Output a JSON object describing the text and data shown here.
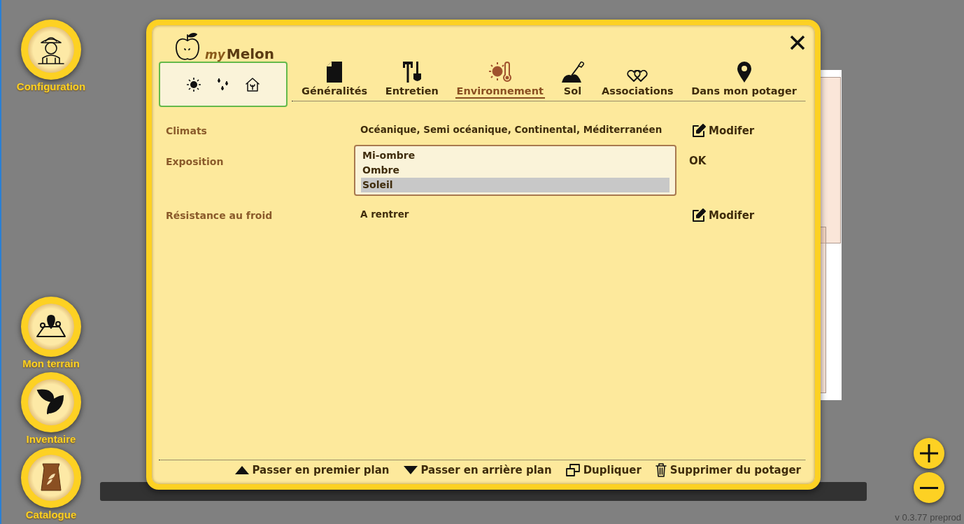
{
  "sidebar": {
    "items": [
      {
        "label": "Configuration"
      },
      {
        "label": "Mon terrain"
      },
      {
        "label": "Inventaire"
      },
      {
        "label": "Catalogue"
      }
    ]
  },
  "version": "v 0.3.77 preprod",
  "dialog": {
    "logo": {
      "prefix": "my",
      "name": "Melon"
    },
    "tabs": [
      {
        "label": "Généralités",
        "selected": false
      },
      {
        "label": "Entretien",
        "selected": false
      },
      {
        "label": "Environnement",
        "selected": true
      },
      {
        "label": "Sol",
        "selected": false
      },
      {
        "label": "Associations",
        "selected": false
      },
      {
        "label": "Dans mon potager",
        "selected": false
      }
    ],
    "rows": [
      {
        "kind": "text",
        "label": "Climats",
        "value": "Océanique, Semi océanique, Continental, Méditerranéen",
        "action": "Modifer"
      },
      {
        "kind": "list",
        "label": "Exposition",
        "options": [
          {
            "label": "Mi-ombre",
            "selected": false
          },
          {
            "label": "Ombre",
            "selected": false
          },
          {
            "label": "Soleil",
            "selected": true
          }
        ],
        "action": "OK"
      },
      {
        "kind": "text",
        "label": "Résistance au froid",
        "value": "A rentrer",
        "action": "Modifer"
      }
    ],
    "footer_actions": [
      "Passer en premier plan",
      "Passer en arrière plan",
      "Dupliquer",
      "Supprimer du potager"
    ]
  }
}
